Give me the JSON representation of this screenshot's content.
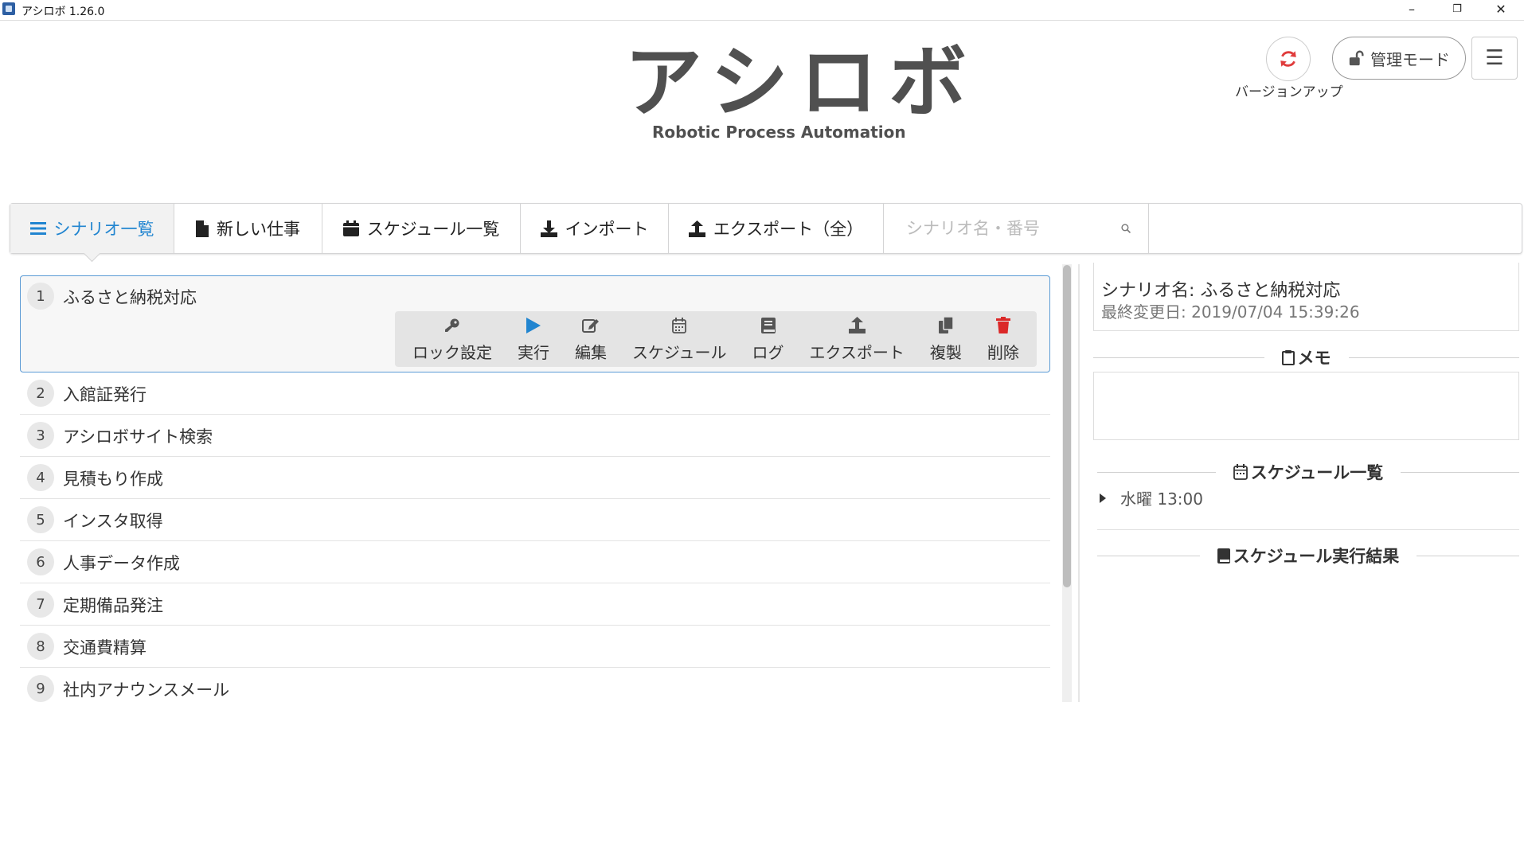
{
  "window": {
    "title": "アシロボ 1.26.0",
    "minimize": "–",
    "restore": "❐",
    "close": "✕"
  },
  "header": {
    "logo": "アシロボ",
    "logo_sub": "Robotic Process Automation",
    "version_up_label": "バージョンアップ",
    "admin_mode_label": "管理モード",
    "menu_icon": "☰"
  },
  "nav": {
    "items": [
      {
        "label": "シナリオ一覧",
        "icon": "list-icon"
      },
      {
        "label": "新しい仕事",
        "icon": "file-icon"
      },
      {
        "label": "スケジュール一覧",
        "icon": "calendar-icon"
      },
      {
        "label": "インポート",
        "icon": "download-icon"
      },
      {
        "label": "エクスポート（全）",
        "icon": "upload-icon"
      }
    ],
    "search_placeholder": "シナリオ名・番号",
    "search_value": ""
  },
  "scenarios": [
    {
      "num": "1",
      "title": "ふるさと納税対応"
    },
    {
      "num": "2",
      "title": "入館証発行"
    },
    {
      "num": "3",
      "title": "アシロボサイト検索"
    },
    {
      "num": "4",
      "title": "見積もり作成"
    },
    {
      "num": "5",
      "title": "インスタ取得"
    },
    {
      "num": "6",
      "title": "人事データ作成"
    },
    {
      "num": "7",
      "title": "定期備品発注"
    },
    {
      "num": "8",
      "title": "交通費精算"
    },
    {
      "num": "9",
      "title": "社内アナウンスメール"
    }
  ],
  "actions": [
    {
      "label": "ロック設定",
      "icon": "key-icon"
    },
    {
      "label": "実行",
      "icon": "play-icon",
      "color": "#2185d0"
    },
    {
      "label": "編集",
      "icon": "edit-icon"
    },
    {
      "label": "スケジュール",
      "icon": "calendar-icon"
    },
    {
      "label": "ログ",
      "icon": "book-icon"
    },
    {
      "label": "エクスポート",
      "icon": "upload-icon"
    },
    {
      "label": "複製",
      "icon": "copy-icon"
    },
    {
      "label": "削除",
      "icon": "trash-icon",
      "color": "#db2828"
    }
  ],
  "detail": {
    "name": "シナリオ名: ふるさと納税対応",
    "updated": "最終変更日: 2019/07/04 15:39:26",
    "memo_header": "メモ",
    "schedule_header": "スケジュール一覧",
    "schedule_item": "水曜 13:00",
    "result_header": "スケジュール実行結果"
  },
  "colors": {
    "accent": "#2185d0",
    "danger": "#db2828",
    "sync": "#e03c3c"
  }
}
